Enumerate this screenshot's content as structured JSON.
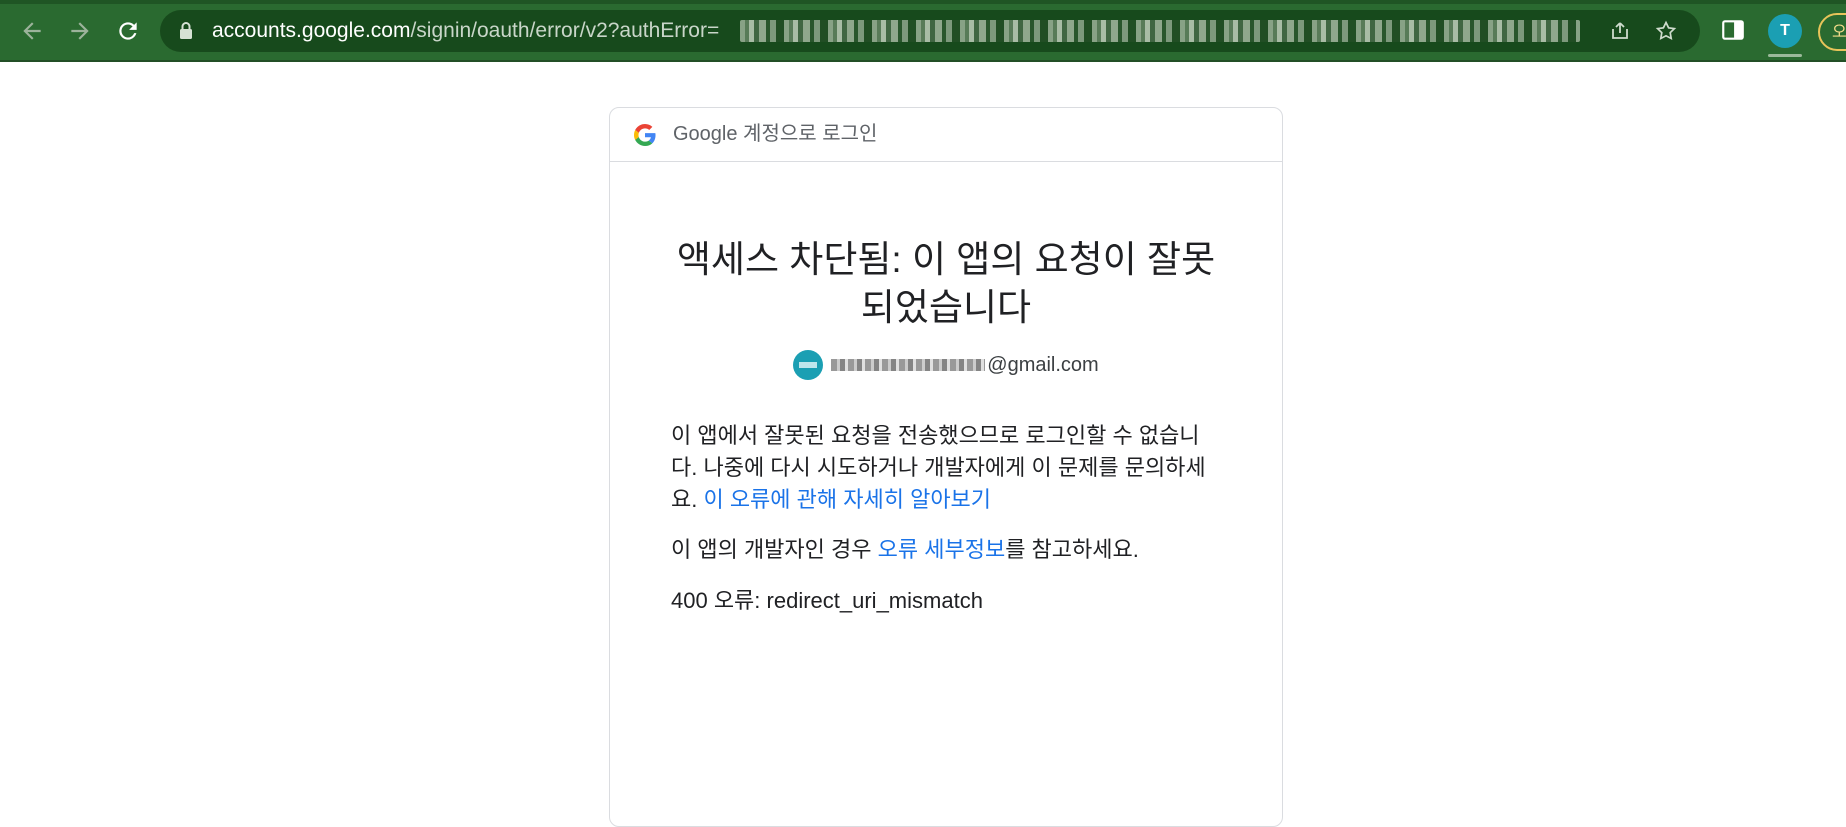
{
  "browser": {
    "url_prefix": "accounts.google.com",
    "url_path": "/signin/oauth/error/v2?authError=",
    "theme_color": "#2a6a30",
    "buttons": {
      "back": "arrow-left-icon",
      "forward": "arrow-right-icon",
      "reload": "reload-icon",
      "share": "share-icon",
      "bookmark": "star-icon",
      "side_panel": "side-panel-icon"
    },
    "profile_initial": "T",
    "update_label": "오"
  },
  "card": {
    "header": "Google 계정으로 로그인",
    "title": "액세스 차단됨: 이 앱의 요청이 잘못되었습니다",
    "account_email_suffix": "@gmail.com",
    "paragraph1_text": "이 앱에서 잘못된 요청을 전송했으므로 로그인할 수 없습니다. 나중에 다시 시도하거나 개발자에게 이 문제를 문의하세요. ",
    "paragraph1_link": "이 오류에 관해 자세히 알아보기",
    "paragraph2_prefix": "이 앱의 개발자인 경우 ",
    "paragraph2_link": "오류 세부정보",
    "paragraph2_suffix": "를 참고하세요.",
    "error_line": "400 오류: redirect_uri_mismatch"
  },
  "colors": {
    "link": "#1a73e8",
    "text": "#202124",
    "muted": "#5f6368",
    "border": "#dadce0"
  }
}
